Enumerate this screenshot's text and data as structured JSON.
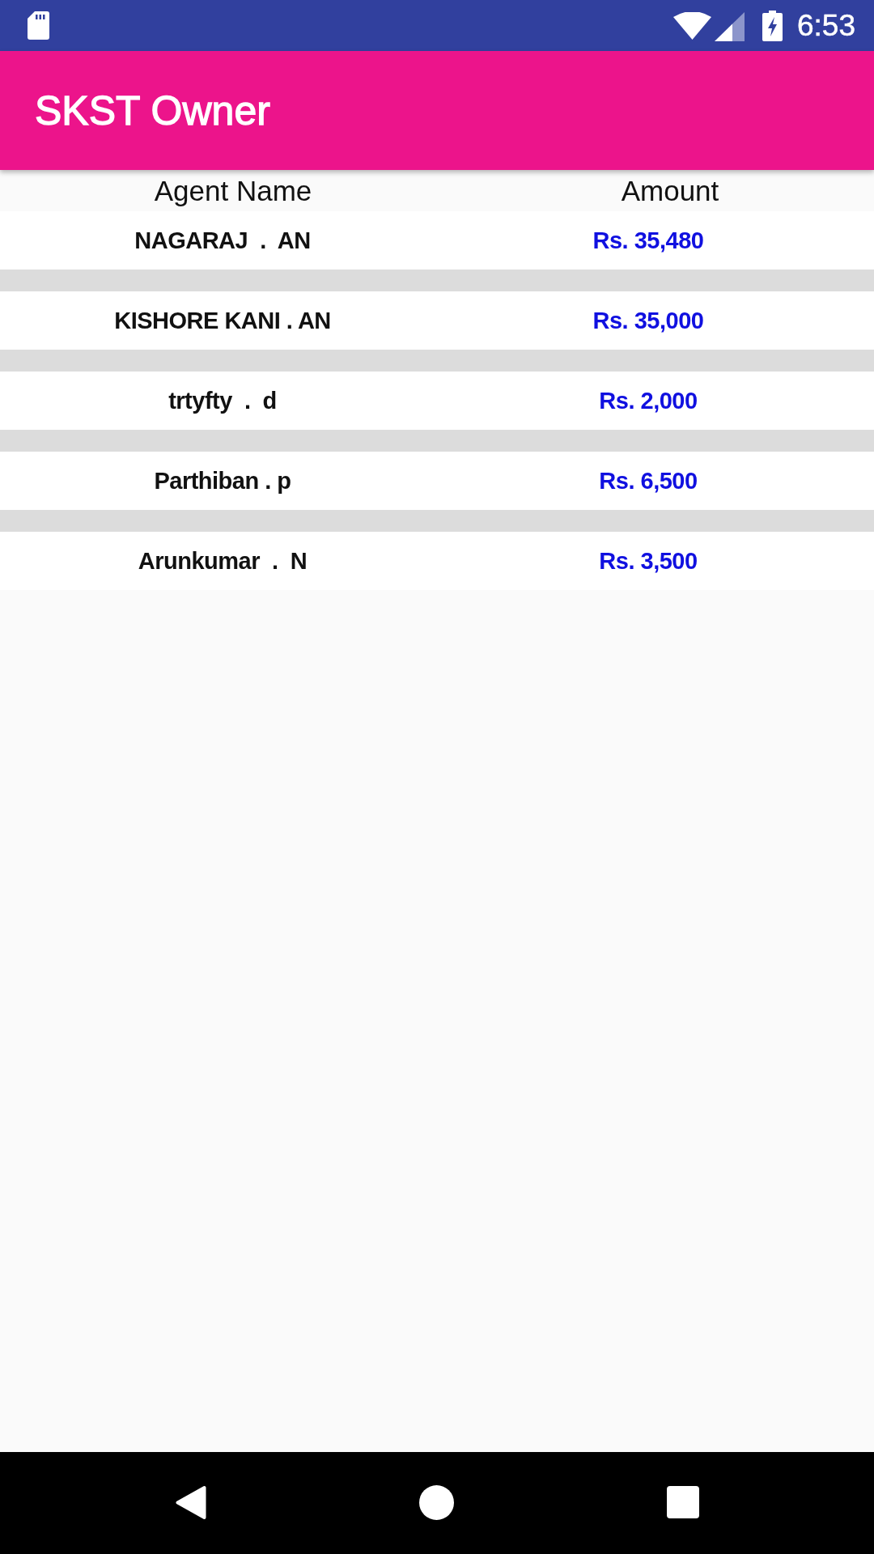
{
  "status_bar": {
    "time": "6:53"
  },
  "app_bar": {
    "title": "SKST Owner"
  },
  "table": {
    "columns": [
      "Agent Name",
      "Amount"
    ],
    "rows": [
      {
        "agent_name": "NAGARAJ  .  AN",
        "amount": "Rs. 35,480"
      },
      {
        "agent_name": "KISHORE KANI . AN",
        "amount": "Rs. 35,000"
      },
      {
        "agent_name": "trtyfty  .  d",
        "amount": "Rs. 2,000"
      },
      {
        "agent_name": "Parthiban . p",
        "amount": "Rs. 6,500"
      },
      {
        "agent_name": "Arunkumar  .  N",
        "amount": "Rs. 3,500"
      }
    ]
  }
}
